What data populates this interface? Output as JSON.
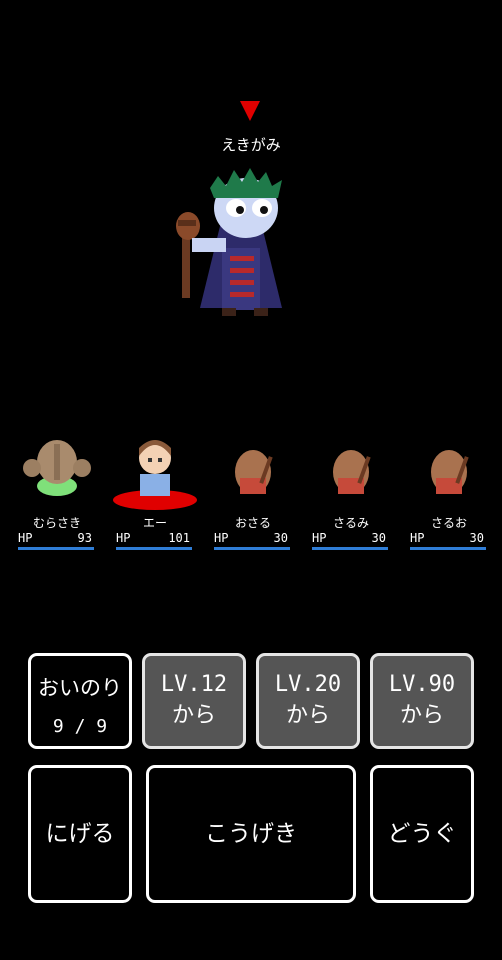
{
  "enemy": {
    "name": "えきがみ"
  },
  "party": [
    {
      "name": "むらさき",
      "hp_label": "HP",
      "hp": "93"
    },
    {
      "name": "エー",
      "hp_label": "HP",
      "hp": "101"
    },
    {
      "name": "おさる",
      "hp_label": "HP",
      "hp": "30"
    },
    {
      "name": "さるみ",
      "hp_label": "HP",
      "hp": "30"
    },
    {
      "name": "さるお",
      "hp_label": "HP",
      "hp": "30"
    }
  ],
  "commands": {
    "prayer": {
      "label": "おいのり",
      "count": "9 / 9"
    },
    "skill1": {
      "level": "LV.12",
      "suffix": "から"
    },
    "skill2": {
      "level": "LV.20",
      "suffix": "から"
    },
    "skill3": {
      "level": "LV.90",
      "suffix": "から"
    },
    "escape": {
      "label": "にげる"
    },
    "attack": {
      "label": "こうげき"
    },
    "item": {
      "label": "どうぐ"
    }
  },
  "colors": {
    "hp_bar": "#2f7dd6",
    "target_marker": "#e00000",
    "locked_button": "#555555"
  }
}
